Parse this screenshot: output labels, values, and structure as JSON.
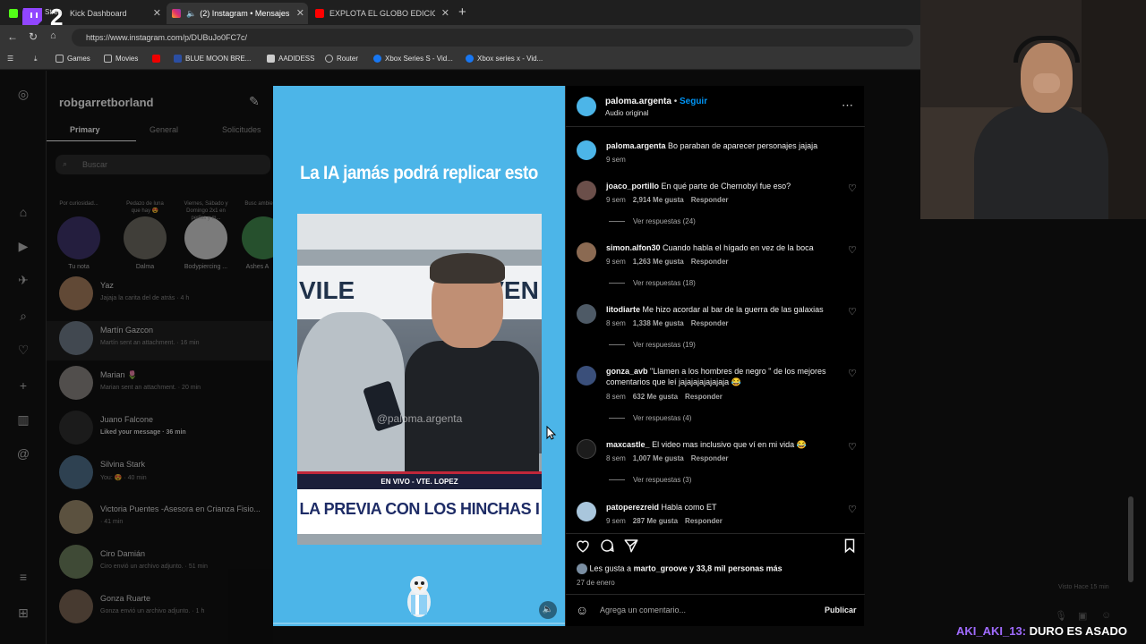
{
  "browser": {
    "tabs": [
      {
        "label": "Kick Dashboard",
        "active": false
      },
      {
        "label": "(2) Instagram • Mensajes",
        "active": true
      },
      {
        "label": "EXPLOTA EL GLOBO EDICION ESP",
        "active": false
      }
    ],
    "url": "https://www.instagram.com/p/DUBuJo0FC7c/",
    "bookmarks": [
      "Games",
      "Movies",
      "BLUE MOON BRE...",
      "AADIDESS",
      "Router",
      "Xbox Series S - Vid...",
      "Xbox series x - Vid..."
    ]
  },
  "overlay": {
    "badge_number": "2",
    "partial_tab_text": "Strea"
  },
  "dm": {
    "account": "robgarretborland",
    "tabs": [
      "Primary",
      "General",
      "Solicitudes"
    ],
    "search_placeholder": "Buscar",
    "notes": [
      {
        "text": "Por curiosidad...",
        "label": "Tu nota"
      },
      {
        "text": "Pedazo de luna que hay 😍",
        "label": "Dalma"
      },
      {
        "text": "Viernes, Sábado y Domingo 2x1 en perfos y m...",
        "label": "Bodypiercing ..."
      },
      {
        "text": "Busc ambie CAB",
        "label": "Ashes A"
      }
    ],
    "threads": [
      {
        "name": "Yaz",
        "sub": "Jajaja la carita del de atrás · 4 h"
      },
      {
        "name": "Martín Gazcon",
        "sub": "Martín sent an attachment. · 16 min"
      },
      {
        "name": "Marian 🌷",
        "sub": "Marian sent an attachment. · 20 min"
      },
      {
        "name": "Juano Falcone",
        "sub": "Liked your message · 36 min"
      },
      {
        "name": "Silvina Stark",
        "sub": "You: 😍 · 40 min"
      },
      {
        "name": "Victoria Puentes -Asesora en Crianza Fisio...",
        "sub": "· 41 min"
      },
      {
        "name": "Ciro Damián",
        "sub": "Ciro envió un archivo adjunto. · 51 min"
      },
      {
        "name": "Gonza Ruarte",
        "sub": "Gonza envió un archivo adjunto. · 1 h"
      }
    ]
  },
  "video": {
    "title": "La IA jamás podrá replicar esto",
    "banner_left": "VILE",
    "banner_right": "NVEN",
    "watermark": "@paloma.argenta",
    "live_text": "EN VIVO - VTE. LOPEZ",
    "lower_third": "LA PREVIA CON LOS HINCHAS I"
  },
  "post": {
    "author": "paloma.argenta",
    "follow_label": "Seguir",
    "audio": "Audio original",
    "caption": {
      "user": "paloma.argenta",
      "text": "Bo paraban de aparecer personajes jajaja",
      "time": "9 sem"
    },
    "comments": [
      {
        "user": "joaco_portillo",
        "text": "En qué parte de Chernobyl fue eso?",
        "time": "9 sem",
        "likes": "2,914 Me gusta",
        "reply": "Responder",
        "replies": "Ver respuestas (24)"
      },
      {
        "user": "simon.alfon30",
        "text": "Cuando habla el hígado en vez de la boca",
        "time": "9 sem",
        "likes": "1,263 Me gusta",
        "reply": "Responder",
        "replies": "Ver respuestas (18)"
      },
      {
        "user": "litodiarte",
        "text": "Me hizo acordar al bar de la guerra de las galaxias",
        "time": "8 sem",
        "likes": "1,338 Me gusta",
        "reply": "Responder",
        "replies": "Ver respuestas (19)"
      },
      {
        "user": "gonza_avb",
        "text": "\"Llamen a los hombres de negro \" de los mejores comentarios que leí jajajajajajajaja 😂",
        "time": "8 sem",
        "likes": "632 Me gusta",
        "reply": "Responder",
        "replies": "Ver respuestas (4)"
      },
      {
        "user": "maxcastle_",
        "text": "El video mas inclusivo que ví en mi vida 😂",
        "time": "8 sem",
        "likes": "1,007 Me gusta",
        "reply": "Responder",
        "replies": "Ver respuestas (3)"
      },
      {
        "user": "patoperezreid",
        "text": "Habla como ET",
        "time": "9 sem",
        "likes": "287 Me gusta",
        "reply": "Responder",
        "replies": ""
      }
    ],
    "likes_prefix": "Les gusta a",
    "likes_user": "marto_groove",
    "likes_suffix": "y 33,8 mil personas más",
    "date": "27 de enero",
    "comment_placeholder": "Agrega un comentario...",
    "publish_label": "Publicar"
  },
  "stream": {
    "chat_user": "AKI_AKI_13:",
    "chat_message": "DURO ES ASADO",
    "faint_text": "Visto Hace 15 min"
  },
  "colors": {
    "accent_blue": "#0095f6",
    "video_bg": "#4cb5e8",
    "chat_user_color": "#a06bff"
  }
}
